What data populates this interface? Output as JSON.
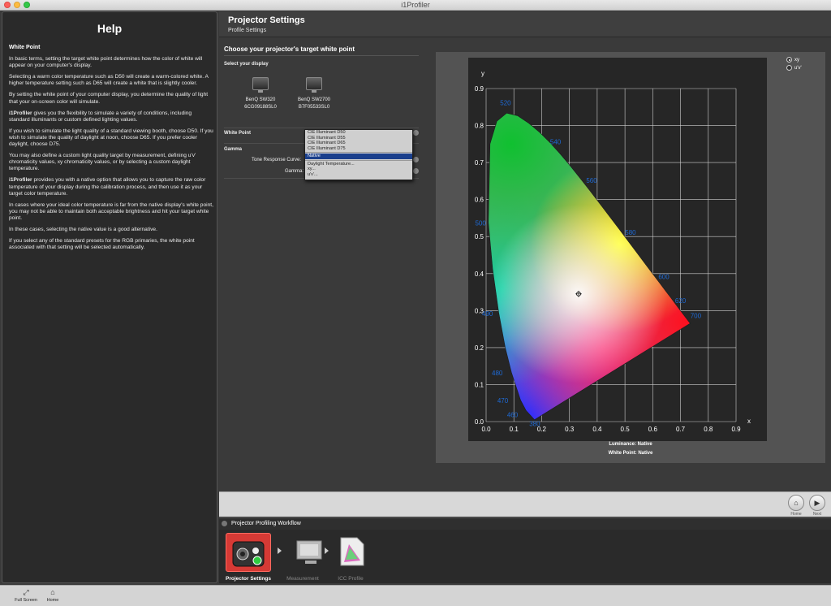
{
  "window": {
    "title": "i1Profiler"
  },
  "help": {
    "title": "Help",
    "section": "White Point",
    "paragraphs": [
      "In basic terms, setting the target white point determines how the color of white will appear on your computer's display.",
      "Selecting a warm color temperature such as D50 will create a warm-colored white. A higher temperature setting such as D65 will create a white that is slightly cooler.",
      "By setting the white point of your computer display, you determine the quality of light that your on-screen color will simulate.",
      "gives you the flexibility to simulate a variety of conditions, including standard illuminants or custom defined lighting values.",
      "If you wish to simulate the light quality of a standard viewing booth, choose D50. If you wish to simulate the quality of daylight at noon, choose D65. If you prefer cooler daylight, choose D75.",
      "You may also define a custom light quality target by measurement, defining u'v' chromaticity values, xy chromaticity values, or by selecting a custom daylight temperature.",
      "provides you with a native option that allows you to capture the raw color temperature of your display during the calibration process, and then use it as your target color temperature.",
      "In cases where your ideal color temperature is far from the native display's white point, you may not be able to maintain both acceptable brightness and hit your target white point.",
      "In these cases, selecting the native value is a good alternative.",
      "If you select any of the standard presets for the RGB primaries, the white point associated with that setting will be selected automatically."
    ],
    "brand": "i1Profiler"
  },
  "header": {
    "title": "Projector Settings",
    "subtitle": "Profile Settings"
  },
  "settings": {
    "heading": "Choose your projector's target white point",
    "select_display": "Select your display",
    "displays": [
      {
        "name": "BenQ SW320",
        "serial": "6CG09188SL0"
      },
      {
        "name": "BenQ SW2700",
        "serial": "B7F05533SL0"
      }
    ],
    "white_point_label": "White Point",
    "gamma_label": "Gamma",
    "tone_response_label": "Tone Response Curve:",
    "gamma_field_label": "Gamma:",
    "dropdown": {
      "items_top": [
        "CIE Illuminant D50",
        "CIE Illuminant D55",
        "CIE Illuminant D65",
        "CIE Illuminant D75"
      ],
      "selected": "Native",
      "items_bottom": [
        "Daylight Temperature...",
        "xy...",
        "u'v'..."
      ]
    }
  },
  "chart": {
    "radio_xy": "xy",
    "radio_uv": "u'v'",
    "luminance_text": "Luminance:  Native",
    "whitepoint_text": "White Point: Native"
  },
  "chart_data": {
    "type": "scatter",
    "xlabel": "x",
    "ylabel": "y",
    "xlim": [
      0,
      0.9
    ],
    "ylim": [
      0,
      0.9
    ],
    "x_ticks": [
      "0.0",
      "0.1",
      "0.2",
      "0.3",
      "0.4",
      "0.5",
      "0.6",
      "0.7",
      "0.8",
      "0.9"
    ],
    "y_ticks": [
      "0.0",
      "0.1",
      "0.2",
      "0.3",
      "0.4",
      "0.5",
      "0.6",
      "0.7",
      "0.8",
      "0.9"
    ],
    "grid": true,
    "locus": [
      [
        0.1741,
        0.005
      ],
      [
        0.144,
        0.0297
      ],
      [
        0.1241,
        0.0578
      ],
      [
        0.0913,
        0.1327
      ],
      [
        0.0687,
        0.2007
      ],
      [
        0.0454,
        0.295
      ],
      [
        0.0235,
        0.4127
      ],
      [
        0.0082,
        0.5384
      ],
      [
        0.0139,
        0.7502
      ],
      [
        0.0389,
        0.812
      ],
      [
        0.0743,
        0.8338
      ],
      [
        0.1142,
        0.8262
      ],
      [
        0.1547,
        0.8059
      ],
      [
        0.1929,
        0.7816
      ],
      [
        0.2296,
        0.7543
      ],
      [
        0.2658,
        0.7243
      ],
      [
        0.3016,
        0.6923
      ],
      [
        0.3373,
        0.6589
      ],
      [
        0.3731,
        0.6245
      ],
      [
        0.4087,
        0.5896
      ],
      [
        0.4441,
        0.5547
      ],
      [
        0.4788,
        0.5202
      ],
      [
        0.5125,
        0.4866
      ],
      [
        0.5448,
        0.4544
      ],
      [
        0.5752,
        0.4242
      ],
      [
        0.6029,
        0.3965
      ],
      [
        0.627,
        0.3725
      ],
      [
        0.6482,
        0.3514
      ],
      [
        0.6658,
        0.334
      ],
      [
        0.6915,
        0.3083
      ],
      [
        0.7347,
        0.2653
      ]
    ],
    "wavelength_labels": [
      {
        "text": "380",
        "x": 0.175,
        "y": -0.012
      },
      {
        "text": "460",
        "x": 0.095,
        "y": 0.012
      },
      {
        "text": "470",
        "x": 0.06,
        "y": 0.05
      },
      {
        "text": "480",
        "x": 0.04,
        "y": 0.125
      },
      {
        "text": "490",
        "x": 0.005,
        "y": 0.285
      },
      {
        "text": "500",
        "x": -0.02,
        "y": 0.53
      },
      {
        "text": "520",
        "x": 0.07,
        "y": 0.855
      },
      {
        "text": "540",
        "x": 0.25,
        "y": 0.75
      },
      {
        "text": "560",
        "x": 0.38,
        "y": 0.645
      },
      {
        "text": "580",
        "x": 0.52,
        "y": 0.505
      },
      {
        "text": "600",
        "x": 0.64,
        "y": 0.385
      },
      {
        "text": "620",
        "x": 0.7,
        "y": 0.32
      },
      {
        "text": "700",
        "x": 0.755,
        "y": 0.28
      }
    ],
    "white_point_marker": {
      "x": 0.333,
      "y": 0.345
    }
  },
  "nav": {
    "home_label": "Home",
    "next_label": "Next"
  },
  "workflow": {
    "title": "Projector Profiling Workflow",
    "steps": [
      "Projector Settings",
      "Measurement",
      "ICC Profile"
    ]
  },
  "footer": {
    "fullscreen_label": "Full Screen",
    "home_label": "Home"
  },
  "colors": {
    "active_step": "#d63a35",
    "dropdown_selected": "#1a3f8c",
    "wavelength_label": "#1e6ad6"
  }
}
